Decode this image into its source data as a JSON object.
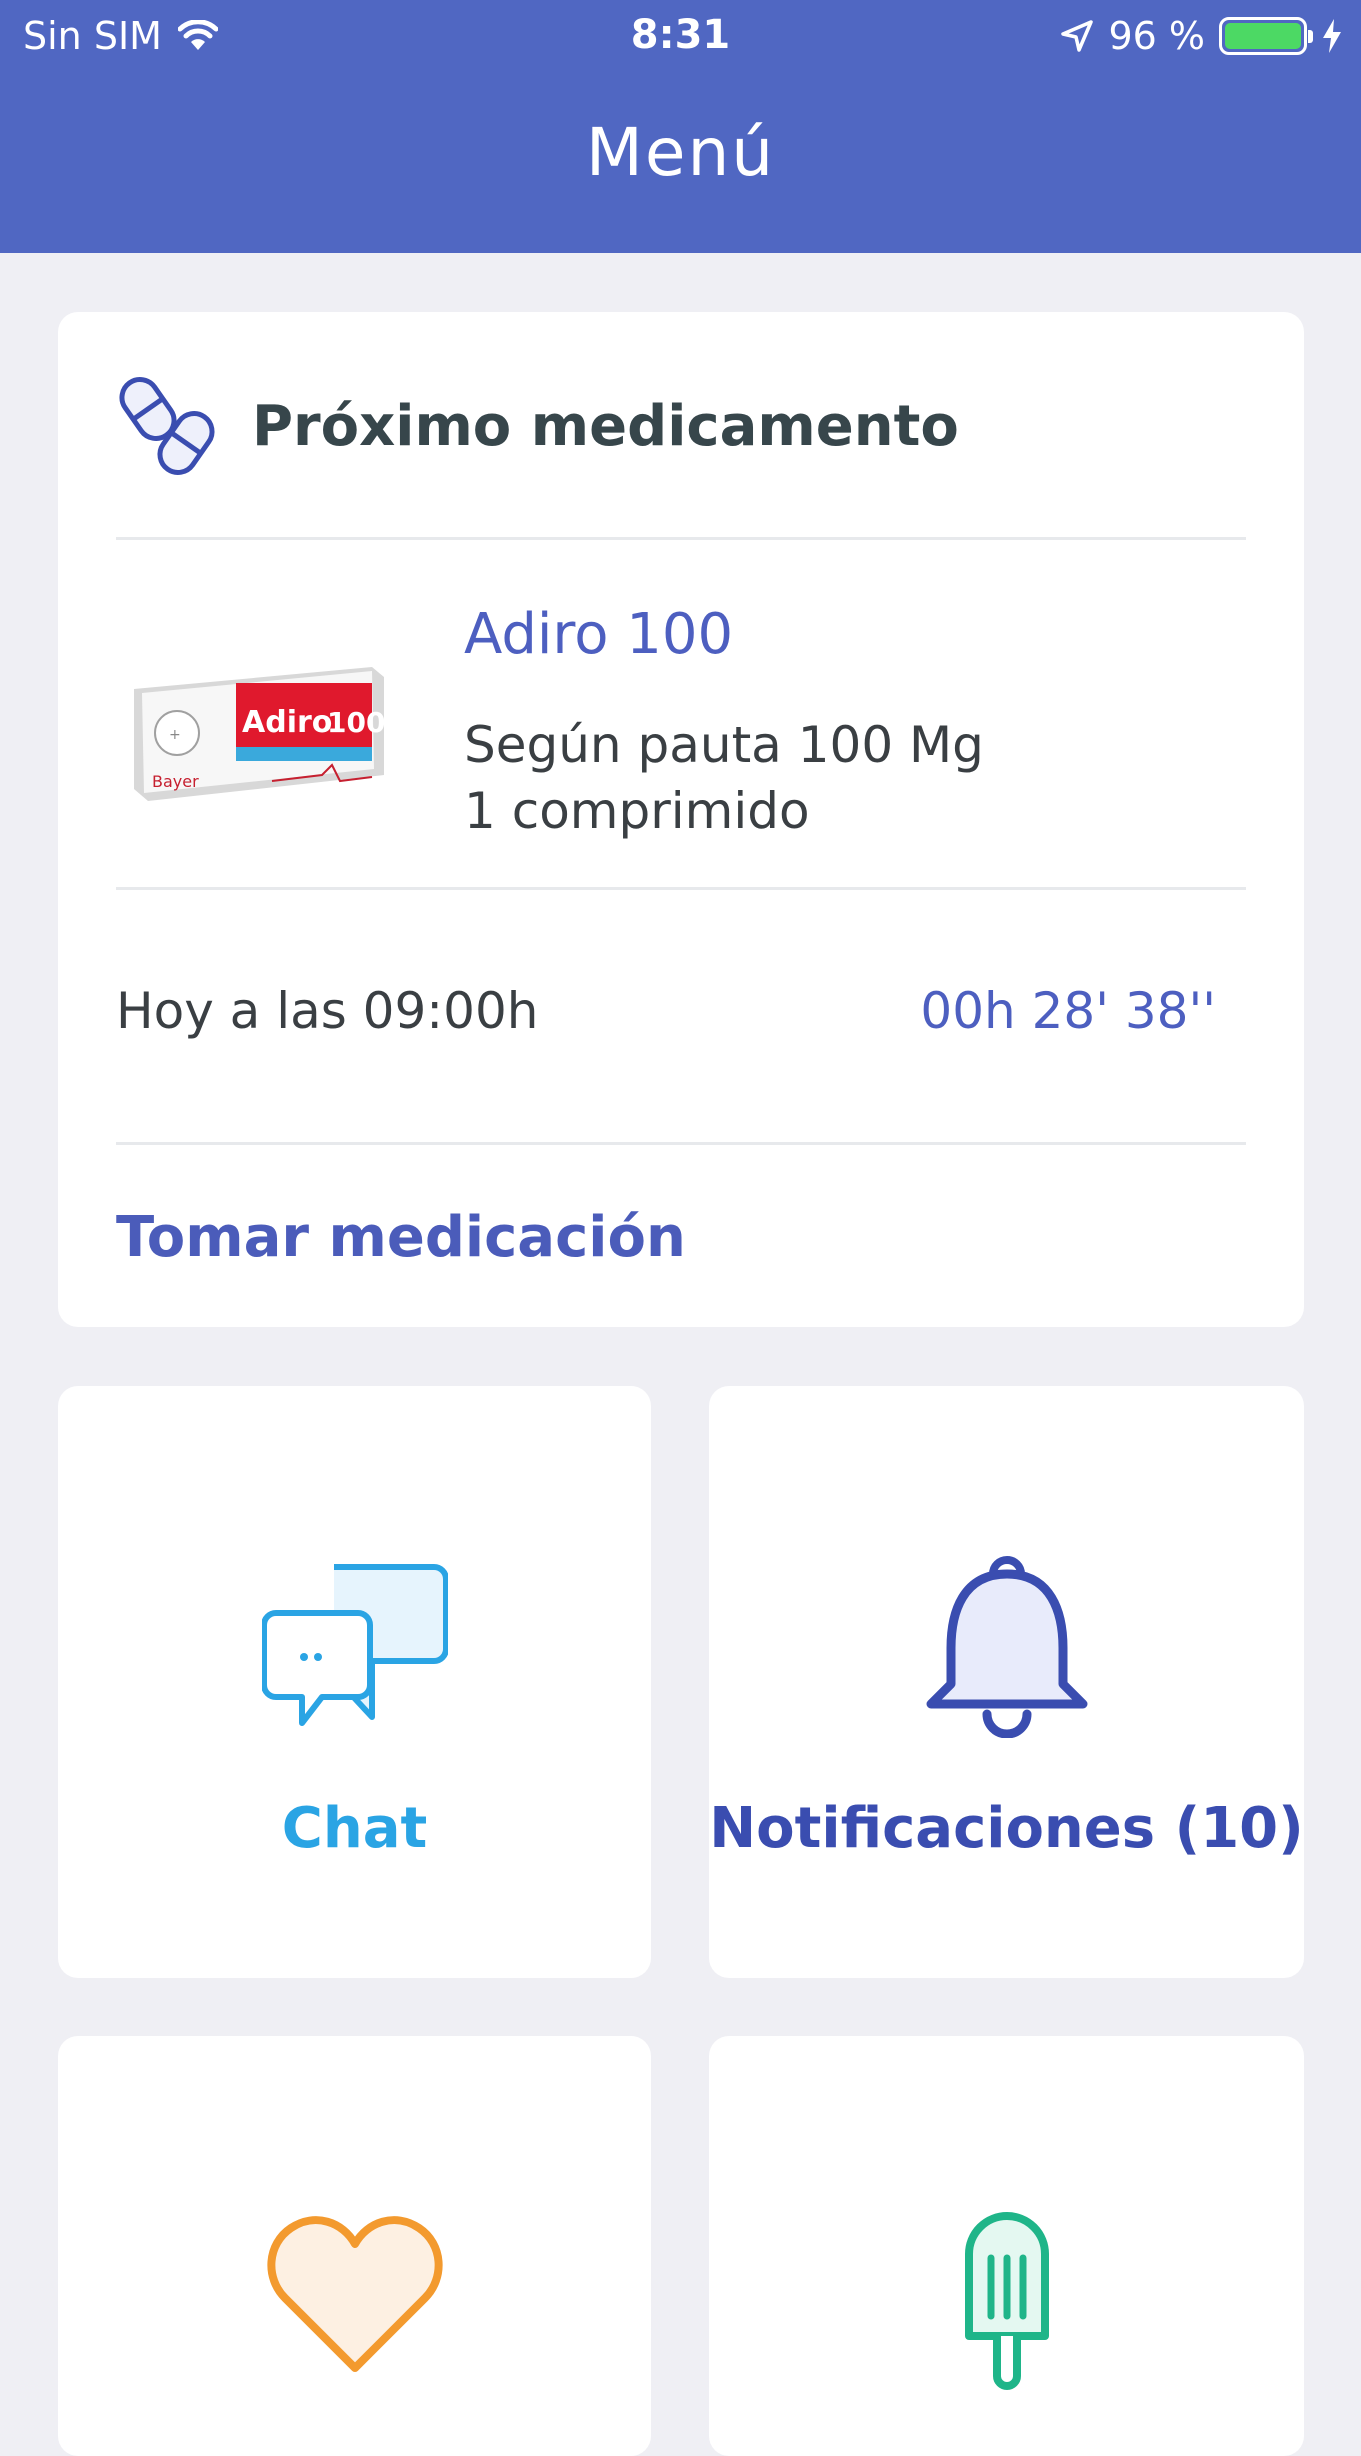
{
  "status_bar": {
    "carrier": "Sin SIM",
    "time": "8:31",
    "battery": "96 %"
  },
  "header": {
    "title": "Menú"
  },
  "next_med": {
    "heading": "Próximo medicamento",
    "drug_name": "Adiro 100",
    "dose_line1": "Según pauta 100 Mg",
    "dose_line2": "1 comprimido",
    "schedule": "Hoy a las 09:00h",
    "countdown": "00h 28' 38''",
    "action": "Tomar medicación",
    "box_brand": "Adiro",
    "box_strength": "100",
    "box_maker": "Bayer"
  },
  "tiles": [
    {
      "label": "Chat",
      "icon": "chat-bubbles-icon",
      "color": "#2aa4e4"
    },
    {
      "label": "Notificaciones (10)",
      "icon": "bell-icon",
      "color": "#3a4db0"
    },
    {
      "label": "",
      "icon": "heart-icon",
      "color": "#f39a2e"
    },
    {
      "label": "",
      "icon": "popsicle-icon",
      "color": "#1fb589"
    }
  ],
  "colors": {
    "header_bg": "#5067c2",
    "accent": "#4d5fc0",
    "page_bg": "#efeff4"
  }
}
